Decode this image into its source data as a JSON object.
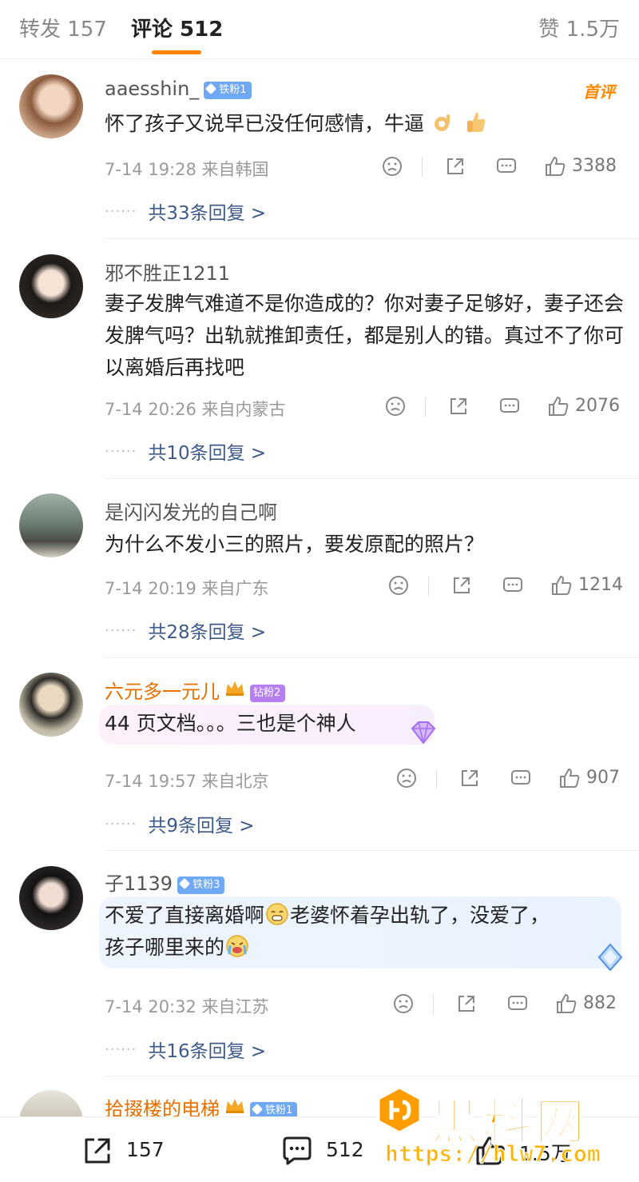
{
  "tabs": {
    "repost": "转发 157",
    "comments": "评论 512",
    "likes": "赞 1.5万"
  },
  "comments": [
    {
      "user": "aaesshin_",
      "badge": "铁粉1",
      "first_tag": "首评",
      "content": "怀了孩子又说早已没任何感情，牛逼",
      "time": "7-14 19:28",
      "location": "来自韩国",
      "likes": "3388",
      "replies": "共33条回复 >"
    },
    {
      "user": "邪不胜正1211",
      "content": "妻子发脾气难道不是你造成的？你对妻子足够好，妻子还会发脾气吗？出轨就推卸责任，都是别人的错。真过不了你可以离婚后再找吧",
      "time": "7-14 20:26",
      "location": "来自内蒙古",
      "likes": "2076",
      "replies": "共10条回复 >"
    },
    {
      "user": "是闪闪发光的自己啊",
      "content": "为什么不发小三的照片，要发原配的照片？",
      "time": "7-14 20:19",
      "location": "来自广东",
      "likes": "1214",
      "replies": "共28条回复 >"
    },
    {
      "user": "六元多一元儿",
      "badge": "钻粉2",
      "content": "44 页文档。。。三也是个神人",
      "time": "7-14 19:57",
      "location": "来自北京",
      "likes": "907",
      "replies": "共9条回复 >"
    },
    {
      "user": "子1139",
      "badge": "铁粉3",
      "content_a": "不爱了直接离婚啊",
      "content_b": "老婆怀着孕出轨了，没爱了，",
      "content_c": "孩子哪里来的",
      "time": "7-14 20:32",
      "location": "来自江苏",
      "likes": "882",
      "replies": "共16条回复 >"
    },
    {
      "user": "拾掇楼的电梯",
      "badge": "铁粉1"
    }
  ],
  "bottom": {
    "repost_count": "157",
    "comment_count": "512",
    "like_count": "1.5万"
  },
  "watermark": {
    "title": "黑料网",
    "url": "https://hlw7.com"
  },
  "colors": {
    "accent": "#ff8200",
    "reply_link": "#3d5a8a",
    "iron_badge": "#6fa8f5",
    "diamond_badge": "#b57ff0",
    "orange_name": "#e86f00"
  }
}
